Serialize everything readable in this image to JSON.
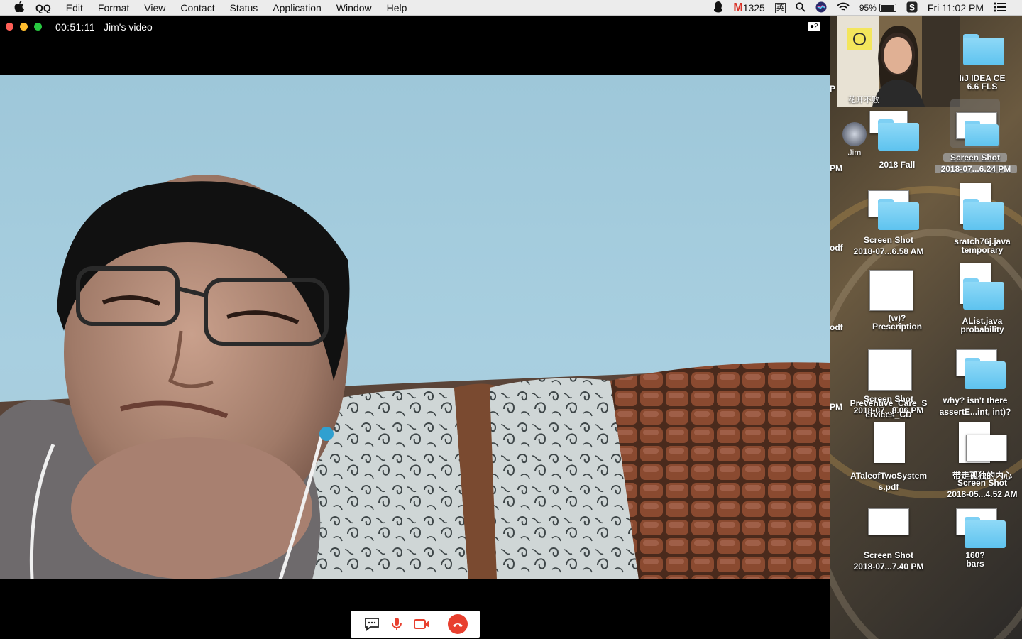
{
  "menubar": {
    "apple": "",
    "items": [
      "QQ",
      "Edit",
      "Format",
      "View",
      "Contact",
      "Status",
      "Application",
      "Window",
      "Help"
    ],
    "mail_count": "1325",
    "input_method": "英",
    "battery": "95%",
    "battery_level": 0.95,
    "clock": "Fri 11:02 PM"
  },
  "video": {
    "timer": "00:51:11",
    "title": "Jim's video",
    "participants": "2"
  },
  "pip": {
    "caption": "花开不败"
  },
  "contact": {
    "name": "Jim"
  },
  "desktop": {
    "edge_labels": [
      "P",
      "PM",
      "odf",
      "odf",
      "PM"
    ],
    "items": [
      {
        "label1": "liJ IDEA CE",
        "label2": "6.6 FLS"
      },
      {
        "label1": "2018 Fall",
        "label2": ""
      },
      {
        "label1": "Screen Shot",
        "label2": "2018-07...6.24 PM"
      },
      {
        "label1": "Screen Shot",
        "label2": "2018-07...6.58 AM"
      },
      {
        "label1": "sratch76j.java",
        "label2": "temporary"
      },
      {
        "label1": "(w)?",
        "label2": "Prescription"
      },
      {
        "label1": "AList.java",
        "label2": "probability"
      },
      {
        "label1": "Screen Shot",
        "label2": "2018-07...8.06 PM"
      },
      {
        "label1": "why? isn't there",
        "label2": "assertE...int, int)?"
      },
      {
        "label1": "Preventive_Care_S",
        "label2": "ervices_CD"
      },
      {
        "label1": "ATaleofTwoSystem",
        "label2": "s.pdf"
      },
      {
        "label1": "带走孤独的内心",
        "label2": ""
      },
      {
        "label1": "Screen Shot",
        "label2": "2018-05...4.52 AM"
      },
      {
        "label1": "Screen Shot",
        "label2": "2018-07...7.40 PM"
      },
      {
        "label1": "160?",
        "label2": "bars"
      }
    ]
  },
  "colors": {
    "close": "#ff5f57",
    "minimize": "#ffbd2e",
    "zoom": "#28c940",
    "control_red": "#e8402f",
    "folder_blue": "#6cc8f2"
  },
  "icons": [
    "apple-icon",
    "qq-penguin-icon",
    "gmail-icon",
    "search-icon",
    "siri-icon",
    "wifi-icon",
    "battery-icon",
    "sogou-icon",
    "notification-list-icon",
    "chat-icon",
    "microphone-icon",
    "camera-icon",
    "hangup-icon",
    "folder-icon"
  ]
}
